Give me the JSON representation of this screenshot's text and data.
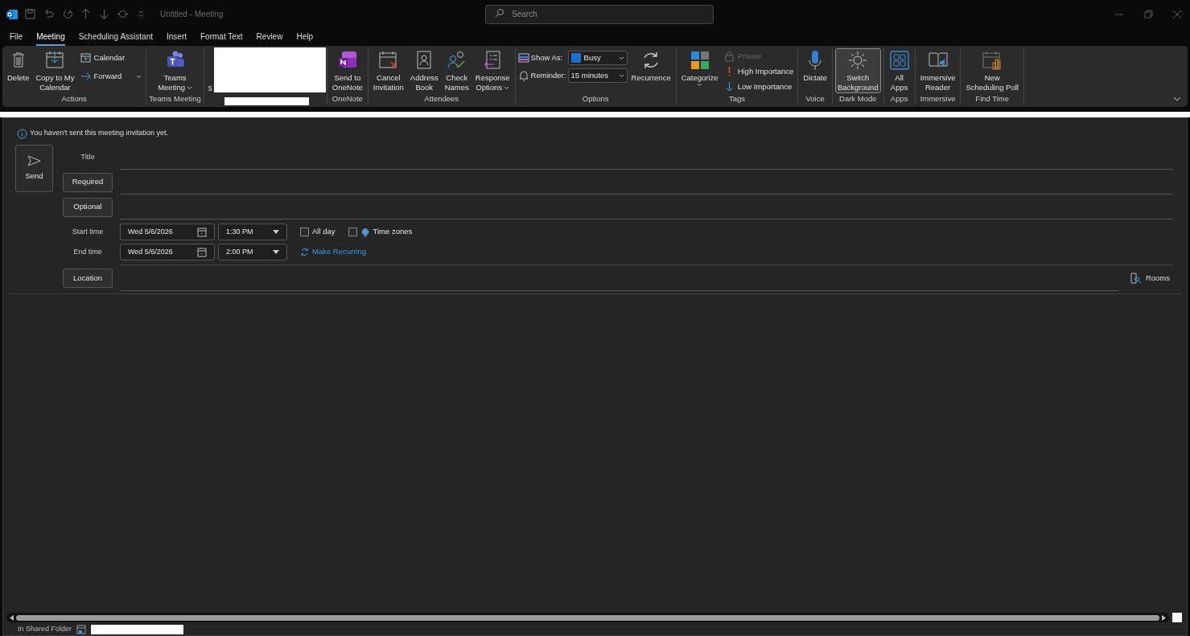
{
  "window": {
    "title": "Untitled - Meeting"
  },
  "search": {
    "placeholder": "Search"
  },
  "menu_tabs": [
    {
      "label": "File",
      "selected": false
    },
    {
      "label": "Meeting",
      "selected": true
    },
    {
      "label": "Scheduling Assistant",
      "selected": false
    },
    {
      "label": "Insert",
      "selected": false
    },
    {
      "label": "Format Text",
      "selected": false
    },
    {
      "label": "Review",
      "selected": false
    },
    {
      "label": "Help",
      "selected": false
    }
  ],
  "ribbon": {
    "groups": [
      {
        "label": "Actions",
        "items": [
          {
            "kind": "large",
            "lines": [
              "Delete"
            ],
            "dropdown": false,
            "on": false
          },
          {
            "kind": "large",
            "lines": [
              "Copy to My",
              "Calendar"
            ],
            "dropdown": false,
            "on": false
          },
          {
            "kind": "stack",
            "entries": [
              {
                "label": "Calendar",
                "dropdown": false,
                "disabled": false
              },
              {
                "label": "Forward",
                "dropdown": true,
                "disabled": false
              }
            ]
          }
        ]
      },
      {
        "label": "Teams Meeting",
        "items": [
          {
            "kind": "large",
            "lines": [
              "Teams",
              "Meeting"
            ],
            "dropdown": true,
            "on": false
          }
        ]
      },
      {
        "kind": "redacted",
        "fragment": "s"
      },
      {
        "label": "OneNote",
        "items": [
          {
            "kind": "large",
            "lines": [
              "Send to",
              "OneNote"
            ],
            "dropdown": false,
            "on": false
          }
        ]
      },
      {
        "label": "Attendees",
        "items": [
          {
            "kind": "large",
            "lines": [
              "Cancel",
              "Invitation"
            ],
            "dropdown": false,
            "on": false
          },
          {
            "kind": "large",
            "lines": [
              "Address",
              "Book"
            ],
            "dropdown": false,
            "on": false
          },
          {
            "kind": "large",
            "lines": [
              "Check",
              "Names"
            ],
            "dropdown": false,
            "on": false
          },
          {
            "kind": "large",
            "lines": [
              "Response",
              "Options"
            ],
            "dropdown": true,
            "on": false
          }
        ]
      },
      {
        "label": "Options",
        "items": [
          {
            "kind": "fields",
            "entries": [
              {
                "label": "Show As:",
                "value": "Busy"
              },
              {
                "label": "Reminder:",
                "value": "15 minutes"
              }
            ]
          },
          {
            "kind": "large",
            "lines": [
              "Recurrence"
            ],
            "dropdown": false,
            "on": false
          }
        ]
      },
      {
        "label": "Tags",
        "items": [
          {
            "kind": "large",
            "lines": [
              "Categorize"
            ],
            "dropdown": true,
            "on": false
          },
          {
            "kind": "stack",
            "entries": [
              {
                "label": "Private",
                "dropdown": false,
                "disabled": true
              },
              {
                "label": "High Importance",
                "dropdown": false,
                "disabled": false
              },
              {
                "label": "Low Importance",
                "dropdown": false,
                "disabled": false
              }
            ]
          }
        ]
      },
      {
        "label": "Voice",
        "items": [
          {
            "kind": "large",
            "lines": [
              "Dictate"
            ],
            "dropdown": false,
            "on": false
          }
        ]
      },
      {
        "label": "Dark Mode",
        "items": [
          {
            "kind": "large",
            "lines": [
              "Switch",
              "Background"
            ],
            "dropdown": false,
            "on": true
          }
        ]
      },
      {
        "label": "Apps",
        "items": [
          {
            "kind": "large",
            "lines": [
              "All",
              "Apps"
            ],
            "dropdown": false,
            "on": false
          }
        ]
      },
      {
        "label": "Immersive",
        "items": [
          {
            "kind": "large",
            "lines": [
              "Immersive",
              "Reader"
            ],
            "dropdown": false,
            "on": false
          }
        ]
      },
      {
        "label": "Find Time",
        "items": [
          {
            "kind": "large",
            "lines": [
              "New",
              "Scheduling Poll"
            ],
            "dropdown": false,
            "on": false
          }
        ]
      }
    ]
  },
  "form": {
    "info": "You haven't sent this meeting invitation yet.",
    "send": "Send",
    "title_label": "Title",
    "required": "Required",
    "optional": "Optional",
    "start": {
      "label": "Start time",
      "date": "Wed 5/6/2026",
      "time": "1:30 PM"
    },
    "end": {
      "label": "End time",
      "date": "Wed 5/6/2026",
      "time": "2:00 PM"
    },
    "all_day": {
      "label": "All day",
      "checked": false
    },
    "time_zones": {
      "label": "Time zones",
      "checked": false
    },
    "make_recurring": "Make Recurring",
    "location": "Location",
    "rooms": "Rooms"
  },
  "status_bar": {
    "text": "In Shared Folder"
  }
}
